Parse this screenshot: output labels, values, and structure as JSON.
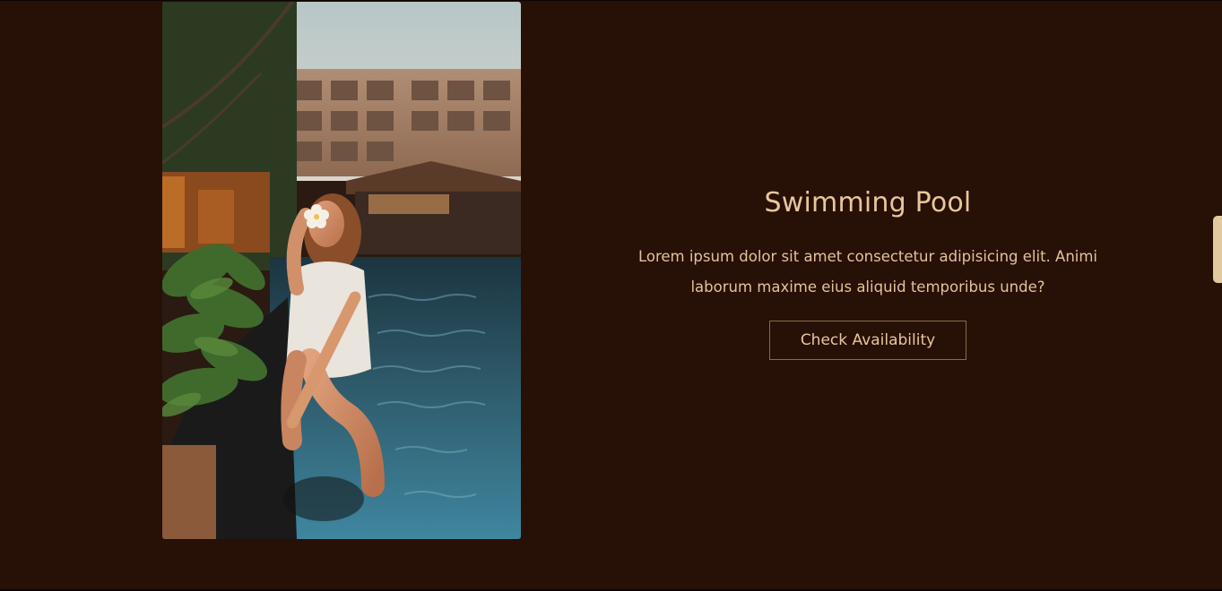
{
  "section": {
    "title": "Swimming Pool",
    "description": "Lorem ipsum dolor sit amet consectetur adipisicing elit. Animi laborum maxime eius aliquid temporibus unde?",
    "button_label": "Check Availability"
  },
  "colors": {
    "background": "#271006",
    "accent": "#e7c79b",
    "button_border": "#8a6a4c",
    "scrollbar_thumb": "#e2c9a0"
  },
  "icons": {
    "photo": "pool-photo"
  }
}
